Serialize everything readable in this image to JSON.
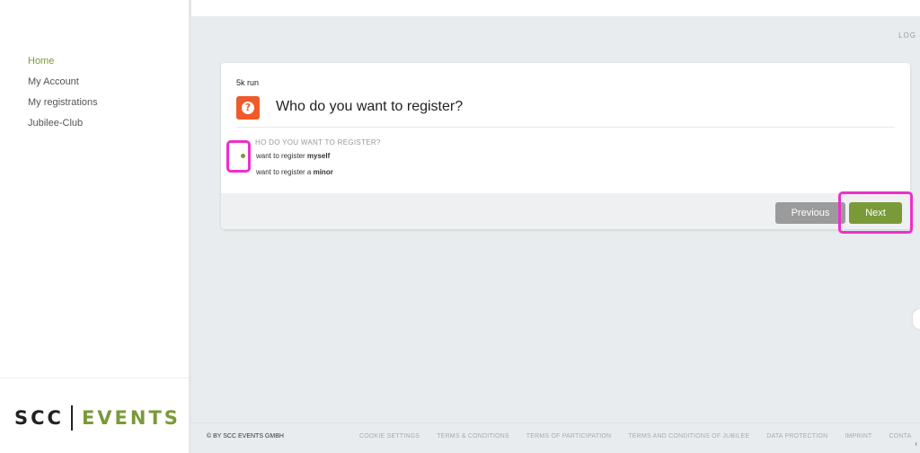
{
  "sidebar": {
    "items": [
      {
        "label": "Home",
        "active": true
      },
      {
        "label": "My Account"
      },
      {
        "label": "My registrations"
      },
      {
        "label": "Jubilee-Club"
      }
    ],
    "logo": {
      "left": "SCC",
      "right": "EVENTS"
    }
  },
  "header": {
    "logout_label": "LOG"
  },
  "card": {
    "event_name": "5k run",
    "question_icon": "question-mark-icon",
    "question_title": "Who do you want to register?",
    "field_label": "HO DO YOU WANT TO REGISTER?",
    "options": [
      {
        "prefix": "want to register ",
        "bold": "myself",
        "selected": true
      },
      {
        "prefix": "want to register a ",
        "bold": "minor",
        "selected": false
      }
    ],
    "previous_label": "Previous",
    "next_label": "Next"
  },
  "footer": {
    "copyright": "© BY SCC EVENTS GMBH",
    "links": [
      "COOKIE SETTINGS",
      "TERMS & CONDITIONS",
      "TERMS OF PARTICIPATION",
      "TERMS AND CONDITIONS OF JUBILEE",
      "DATA PROTECTION",
      "IMPRINT",
      "CONTA"
    ]
  },
  "colors": {
    "accent": "#7a9a3a",
    "question_badge": "#ef5a2a",
    "highlight": "#ee2ecc",
    "previous_button": "#9b9b9b"
  }
}
